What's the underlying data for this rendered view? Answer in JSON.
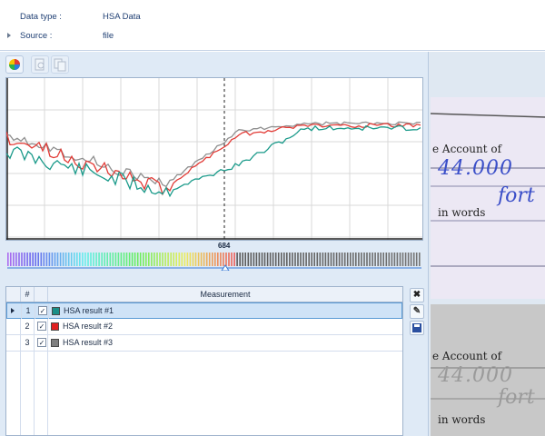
{
  "info": {
    "rows": [
      {
        "label": "Data type :",
        "value": "HSA Data"
      },
      {
        "label": "Source :",
        "value": "file"
      }
    ]
  },
  "toolbar": {
    "buttons": [
      {
        "name": "color-wheel-icon",
        "enabled": true
      },
      {
        "name": "zoom-page-icon",
        "enabled": false
      },
      {
        "name": "copy-page-icon",
        "enabled": false
      }
    ]
  },
  "plot": {
    "marker_label": "684",
    "series": [
      {
        "color": "#1a9a8a"
      },
      {
        "color": "#e23b36"
      },
      {
        "color": "#8f8f8f"
      }
    ]
  },
  "table": {
    "headers": {
      "num": "#",
      "check": "",
      "measurement": "Measurement"
    },
    "rows": [
      {
        "num": "1",
        "checked": "✓",
        "name": "HSA result #1",
        "color": "#1a8f88",
        "selected": true
      },
      {
        "num": "2",
        "checked": "✓",
        "name": "HSA result #2",
        "color": "#e02020",
        "selected": false
      },
      {
        "num": "3",
        "checked": "✓",
        "name": "HSA result #3",
        "color": "#808080",
        "selected": false
      }
    ]
  },
  "side_buttons": [
    {
      "name": "close-icon",
      "glyph": "✖",
      "color": "#222222"
    },
    {
      "name": "edit-icon",
      "glyph": "✎",
      "color": "#333333"
    },
    {
      "name": "save-icon",
      "glyph": "▪",
      "color": "#2a4fa0"
    }
  ],
  "document_images": {
    "top": {
      "line1": "e Account of",
      "line2": "44.000",
      "line3": "fort",
      "line4": "in words"
    },
    "bottom": {
      "line1": "e Account of",
      "line2": "44.000",
      "line3": "fort",
      "line4": "in words"
    }
  }
}
